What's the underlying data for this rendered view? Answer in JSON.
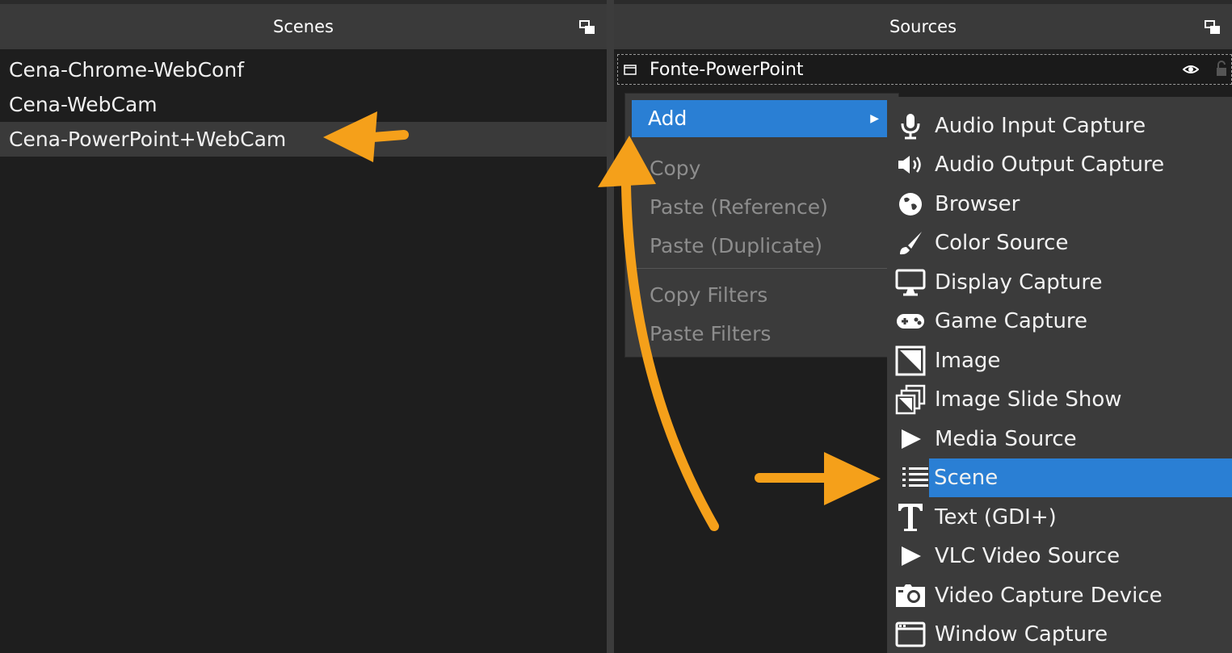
{
  "scenes": {
    "header": "Scenes",
    "items": [
      "Cena-Chrome-WebConf",
      "Cena-WebCam",
      "Cena-PowerPoint+WebCam"
    ]
  },
  "sources": {
    "header": "Sources",
    "items": [
      "Fonte-PowerPoint"
    ]
  },
  "context_menu": {
    "add": "Add",
    "copy": "Copy",
    "paste_reference": "Paste (Reference)",
    "paste_duplicate": "Paste (Duplicate)",
    "copy_filters": "Copy Filters",
    "paste_filters": "Paste Filters"
  },
  "add_submenu": [
    {
      "label": "Audio Input Capture",
      "icon": "microphone-icon"
    },
    {
      "label": "Audio Output Capture",
      "icon": "speaker-icon"
    },
    {
      "label": "Browser",
      "icon": "globe-icon"
    },
    {
      "label": "Color Source",
      "icon": "brush-icon"
    },
    {
      "label": "Display Capture",
      "icon": "monitor-icon"
    },
    {
      "label": "Game Capture",
      "icon": "gamepad-icon"
    },
    {
      "label": "Image",
      "icon": "image-icon"
    },
    {
      "label": "Image Slide Show",
      "icon": "slideshow-icon"
    },
    {
      "label": "Media Source",
      "icon": "play-icon"
    },
    {
      "label": "Scene",
      "icon": "list-icon"
    },
    {
      "label": "Text (GDI+)",
      "icon": "text-icon"
    },
    {
      "label": "VLC Video Source",
      "icon": "play-icon"
    },
    {
      "label": "Video Capture Device",
      "icon": "camera-icon"
    },
    {
      "label": "Window Capture",
      "icon": "window-icon"
    }
  ],
  "colors": {
    "highlight": "#2a7fd4",
    "annotation_arrow": "#f5a01a",
    "panel_bg": "#1e1e1e",
    "menu_bg": "#3b3b3b"
  }
}
